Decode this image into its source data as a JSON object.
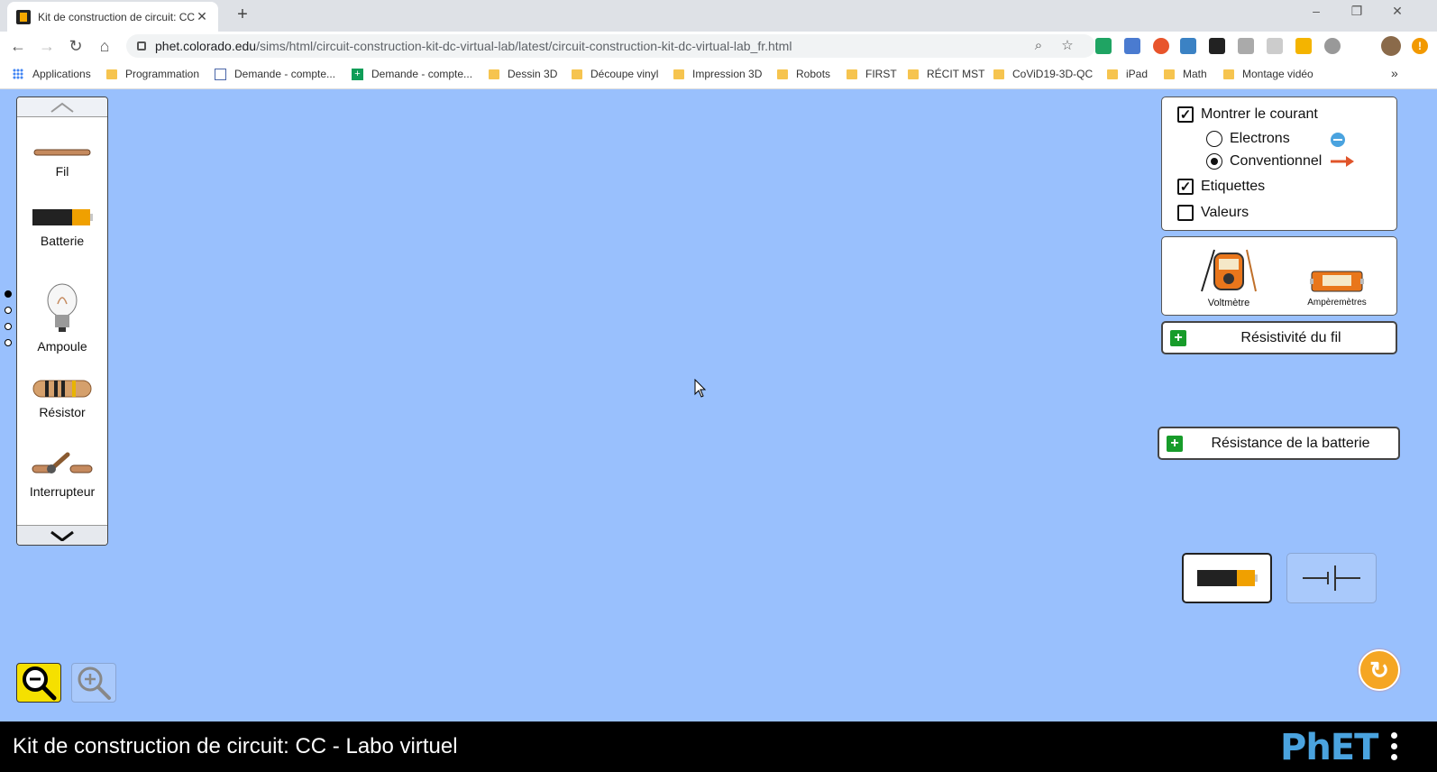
{
  "browser": {
    "tab_title": "Kit de construction de circuit: CC",
    "new_tab": "+",
    "url_host": "phet.colorado.edu",
    "url_path": "/sims/html/circuit-construction-kit-dc-virtual-lab/latest/circuit-construction-kit-dc-virtual-lab_fr.html",
    "window_minimize": "–",
    "window_restore": "❐",
    "window_close": "✕"
  },
  "bookmarks": [
    "Applications",
    "Programmation",
    "Demande - compte...",
    "Demande - compte...",
    "Dessin 3D",
    "Découpe vinyl",
    "Impression 3D",
    "Robots",
    "FIRST",
    "RÉCIT MST",
    "CoViD19-3D-QC",
    "iPad",
    "Math",
    "Montage vidéo"
  ],
  "bookmarks_more": "»",
  "toolbox": {
    "items": [
      "Fil",
      "Batterie",
      "Ampoule",
      "Résistor",
      "Interrupteur"
    ]
  },
  "controls": {
    "show_current": "Montrer le courant",
    "electrons": "Electrons",
    "conventional": "Conventionnel",
    "labels": "Etiquettes",
    "values": "Valeurs",
    "show_current_checked": true,
    "labels_checked": true,
    "values_checked": false,
    "selected_current_mode": "Conventionnel"
  },
  "sensors": {
    "voltmeter": "Voltmètre",
    "ammeter": "Ampèremètres"
  },
  "accordions": {
    "wire_resistivity": "Résistivité du fil",
    "battery_resistance": "Résistance de la batterie"
  },
  "footer": {
    "sim_title": "Kit de construction de circuit: CC - Labo virtuel",
    "logo": "PhET"
  }
}
